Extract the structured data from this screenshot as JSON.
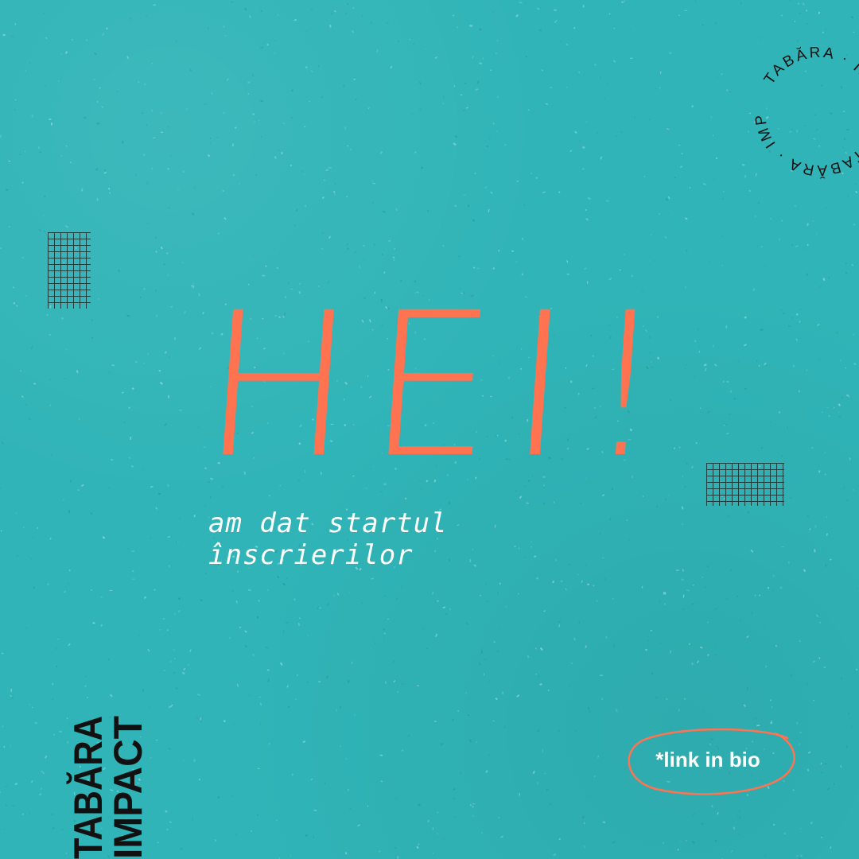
{
  "headline": "HEI!",
  "subheadline": "am dat startul înscrierilor",
  "badge": {
    "circular_text": "TABĂRA · IMPACT · TABĂRA · IMPACT ·"
  },
  "logo": {
    "line1": "TABĂRA",
    "line2": "IMPACT"
  },
  "link": {
    "label": "*link in bio"
  },
  "colors": {
    "background": "#30b4b7",
    "accent": "#ff7351",
    "text_light": "#ffffff",
    "text_dark": "#111111"
  }
}
